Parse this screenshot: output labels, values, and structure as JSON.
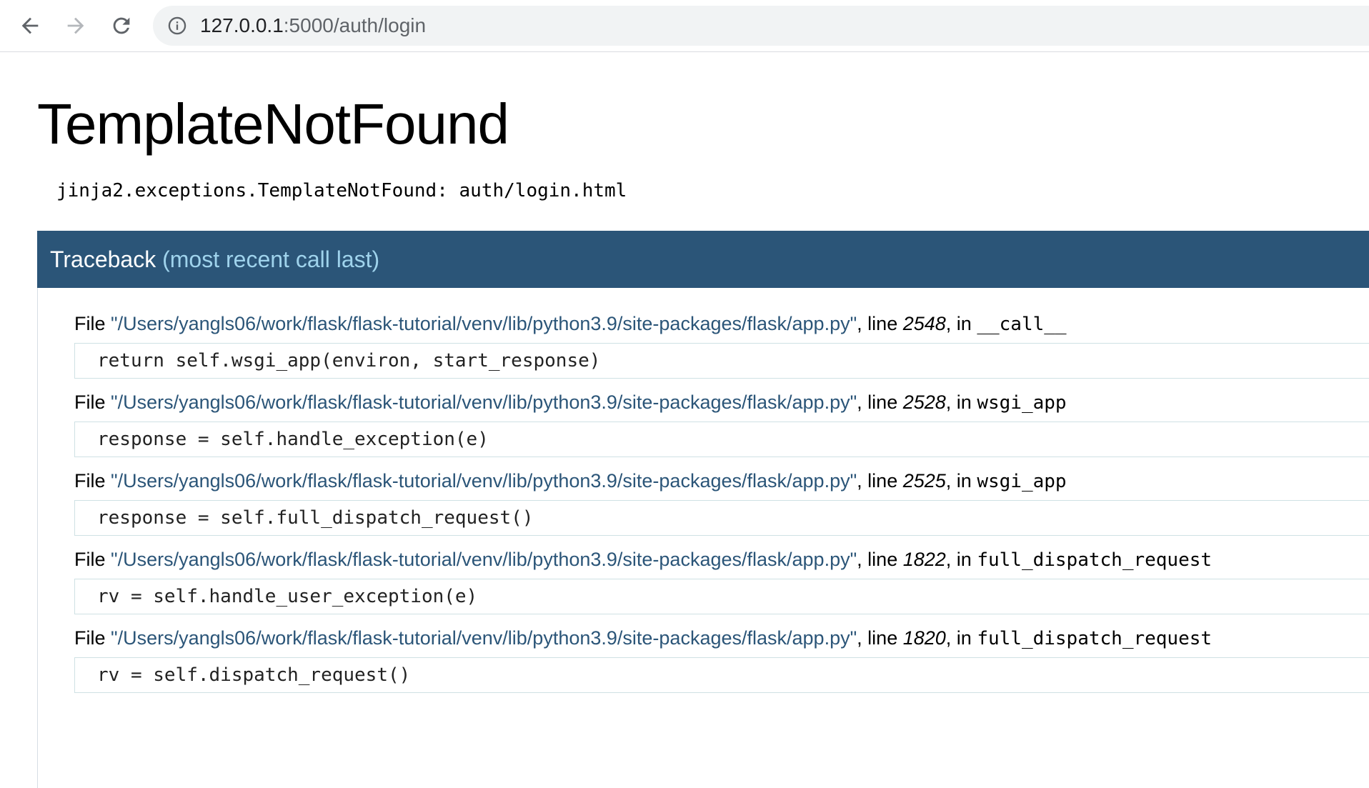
{
  "browser": {
    "url_host": "127.0.0.1",
    "url_rest": ":5000/auth/login",
    "icons": {
      "back": "arrow-left-icon",
      "forward": "arrow-right-icon",
      "reload": "reload-icon",
      "site_info": "info-icon"
    }
  },
  "page": {
    "title": "TemplateNotFound",
    "error_message": "jinja2.exceptions.TemplateNotFound: auth/login.html",
    "traceback_label": "Traceback",
    "traceback_sub": "(most recent call last)",
    "header_color": "#2b5578",
    "frames": [
      {
        "prefix": "File ",
        "filename": "\"/Users/yangls06/work/flask/flask-tutorial/venv/lib/python3.9/site-packages/flask/app.py\"",
        "line_label": ", line ",
        "lineno": "2548",
        "in_label": ", in ",
        "funcname": "__call__",
        "code": "return self.wsgi_app(environ, start_response)"
      },
      {
        "prefix": "File ",
        "filename": "\"/Users/yangls06/work/flask/flask-tutorial/venv/lib/python3.9/site-packages/flask/app.py\"",
        "line_label": ", line ",
        "lineno": "2528",
        "in_label": ", in ",
        "funcname": "wsgi_app",
        "code": "response = self.handle_exception(e)"
      },
      {
        "prefix": "File ",
        "filename": "\"/Users/yangls06/work/flask/flask-tutorial/venv/lib/python3.9/site-packages/flask/app.py\"",
        "line_label": ", line ",
        "lineno": "2525",
        "in_label": ", in ",
        "funcname": "wsgi_app",
        "code": "response = self.full_dispatch_request()"
      },
      {
        "prefix": "File ",
        "filename": "\"/Users/yangls06/work/flask/flask-tutorial/venv/lib/python3.9/site-packages/flask/app.py\"",
        "line_label": ", line ",
        "lineno": "1822",
        "in_label": ", in ",
        "funcname": "full_dispatch_request",
        "code": "rv = self.handle_user_exception(e)"
      },
      {
        "prefix": "File ",
        "filename": "\"/Users/yangls06/work/flask/flask-tutorial/venv/lib/python3.9/site-packages/flask/app.py\"",
        "line_label": ", line ",
        "lineno": "1820",
        "in_label": ", in ",
        "funcname": "full_dispatch_request",
        "code": "rv = self.dispatch_request()"
      }
    ]
  }
}
